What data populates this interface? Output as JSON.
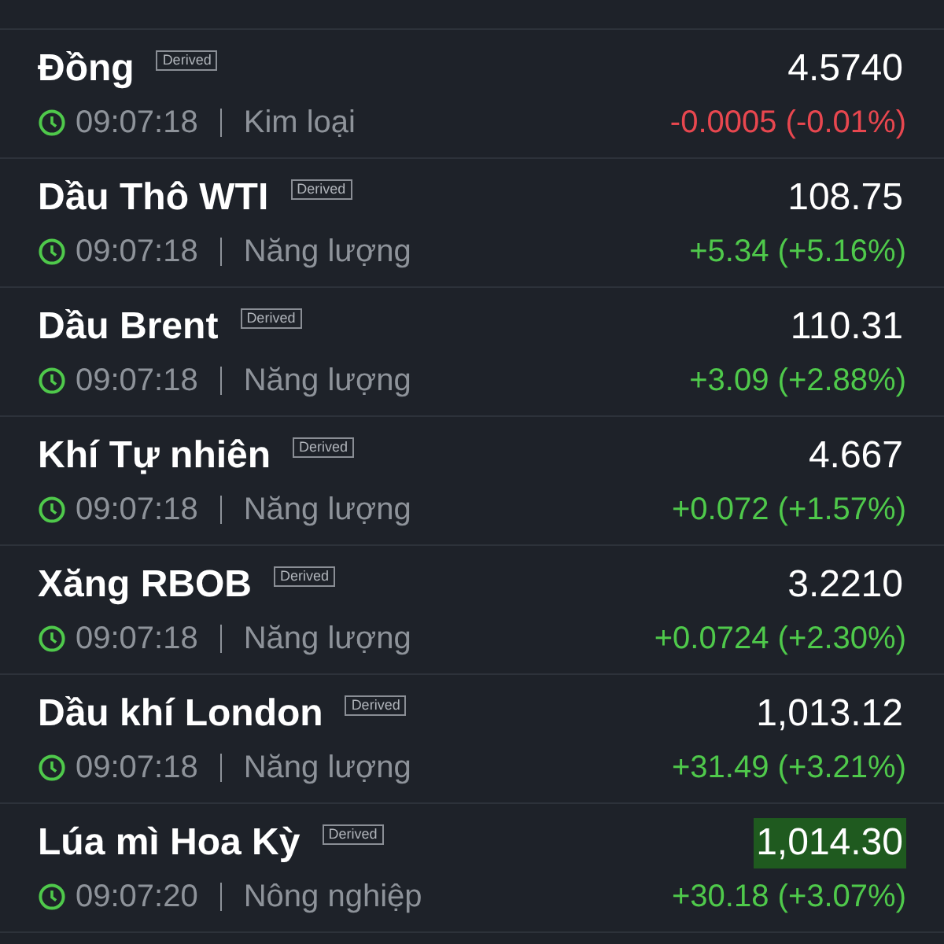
{
  "quotes": [
    {
      "name": "Đồng",
      "badge": "Derived",
      "time": "09:07:18",
      "category": "Kim loại",
      "price": "4.5740",
      "change": "-0.0005 (-0.01%)",
      "color": "#e8474f",
      "highlighted": false
    },
    {
      "name": "Dầu Thô WTI",
      "badge": "Derived",
      "time": "09:07:18",
      "category": "Năng lượng",
      "price": "108.75",
      "change": "+5.34 (+5.16%)",
      "color": "#4fc94b",
      "highlighted": false
    },
    {
      "name": "Dầu Brent",
      "badge": "Derived",
      "time": "09:07:18",
      "category": "Năng lượng",
      "price": "110.31",
      "change": "+3.09 (+2.88%)",
      "color": "#4fc94b",
      "highlighted": false
    },
    {
      "name": "Khí Tự nhiên",
      "badge": "Derived",
      "time": "09:07:18",
      "category": "Năng lượng",
      "price": "4.667",
      "change": "+0.072 (+1.57%)",
      "color": "#4fc94b",
      "highlighted": false
    },
    {
      "name": "Xăng RBOB",
      "badge": "Derived",
      "time": "09:07:18",
      "category": "Năng lượng",
      "price": "3.2210",
      "change": "+0.0724 (+2.30%)",
      "color": "#4fc94b",
      "highlighted": false
    },
    {
      "name": "Dầu khí London",
      "badge": "Derived",
      "time": "09:07:18",
      "category": "Năng lượng",
      "price": "1,013.12",
      "change": "+31.49 (+3.21%)",
      "color": "#4fc94b",
      "highlighted": false
    },
    {
      "name": "Lúa mì Hoa Kỳ",
      "badge": "Derived",
      "time": "09:07:20",
      "category": "Nông nghiệp",
      "price": "1,014.30",
      "change": "+30.18 (+3.07%)",
      "color": "#4fc94b",
      "highlighted": true
    }
  ]
}
